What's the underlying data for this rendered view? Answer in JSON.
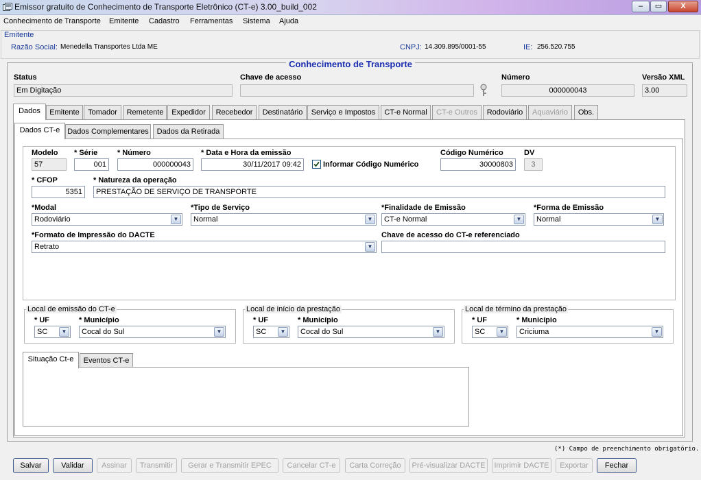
{
  "window": {
    "title": "Emissor gratuito de Conhecimento de Transporte Eletrônico (CT-e) 3.00_build_002",
    "minimize": "–",
    "maximize": "▭",
    "close": "X"
  },
  "menu": [
    "Conhecimento de Transporte",
    "Emitente",
    "Cadastro",
    "Ferramentas",
    "Sistema",
    "Ajuda"
  ],
  "emitente": {
    "group_label": "Emitente",
    "razao_label": "Razão Social:",
    "razao_value": "Menedella Transportes Ltda ME",
    "cnpj_label": "CNPJ:",
    "cnpj_value": "14.309.895/0001-55",
    "ie_label": "IE:",
    "ie_value": "256.520.755"
  },
  "main_title": "Conhecimento de Transporte",
  "header": {
    "status_label": "Status",
    "status_value": "Em Digitação",
    "chave_label": "Chave de acesso",
    "chave_value": "",
    "numero_label": "Número",
    "numero_value": "000000043",
    "versao_label": "Versão XML",
    "versao_value": "3.00"
  },
  "main_tabs": [
    "Dados",
    "Emitente",
    "Tomador",
    "Remetente",
    "Expedidor",
    "Recebedor",
    "Destinatário",
    "Serviço e Impostos",
    "CT-e Normal",
    "CT-e Outros",
    "Rodoviário",
    "Aquaviário",
    "Obs."
  ],
  "sub_tabs": [
    "Dados CT-e",
    "Dados Complementares",
    "Dados da Retirada"
  ],
  "form": {
    "modelo_label": "Modelo",
    "modelo_value": "57",
    "serie_label": "* Série",
    "serie_value": "001",
    "numero_label": "* Número",
    "numero_value": "000000043",
    "data_label": "* Data e Hora da emissão",
    "data_value": "30/11/2017 09:42",
    "informar_label": "Informar Código Numérico",
    "codigo_label": "Código Numérico",
    "codigo_value": "30000803",
    "dv_label": "DV",
    "dv_value": "3",
    "cfop_label": "* CFOP",
    "cfop_value": "5351",
    "natureza_label": "* Natureza da operação",
    "natureza_value": "PRESTAÇÃO DE SERVIÇO DE TRANSPORTE",
    "modal_label": "*Modal",
    "modal_value": "Rodoviário",
    "tipo_label": "*Tipo de Serviço",
    "tipo_value": "Normal",
    "finalidade_label": "*Finalidade de Emissão",
    "finalidade_value": "CT-e Normal",
    "forma_label": "*Forma de Emissão",
    "forma_value": "Normal",
    "formato_label": "*Formato de Impressão do DACTE",
    "formato_value": "Retrato",
    "chave_ref_label": "Chave de acesso do CT-e referenciado",
    "chave_ref_value": ""
  },
  "locais": {
    "emissao_title": "Local de emissão do CT-e",
    "inicio_title": "Local de início da prestação",
    "termino_title": "Local de término da prestação",
    "uf_label": "* UF",
    "mun_label": "* Município",
    "emissao_uf": "SC",
    "emissao_mun": "Cocal do Sul",
    "inicio_uf": "SC",
    "inicio_mun": "Cocal do Sul",
    "termino_uf": "SC",
    "termino_mun": "Criciuma"
  },
  "situacao_tabs": [
    "Situação Ct-e",
    "Eventos CT-e"
  ],
  "footnote": "(*) Campo de preenchimento obrigatório.",
  "buttons": [
    {
      "label": "Salvar",
      "enabled": true
    },
    {
      "label": "Validar",
      "enabled": true
    },
    {
      "label": "Assinar",
      "enabled": false
    },
    {
      "label": "Transmitir",
      "enabled": false
    },
    {
      "label": "Gerar e Transmitir EPEC",
      "enabled": false
    },
    {
      "label": "Cancelar CT-e",
      "enabled": false
    },
    {
      "label": "Carta Correção",
      "enabled": false
    },
    {
      "label": "Pré-visualizar DACTE",
      "enabled": false
    },
    {
      "label": "Imprimir DACTE",
      "enabled": false
    },
    {
      "label": "Exportar",
      "enabled": false
    },
    {
      "label": "Fechar",
      "enabled": true
    }
  ],
  "colors": {
    "title_blue": "#1c2fb0",
    "label_blue": "#1a3a9a"
  }
}
